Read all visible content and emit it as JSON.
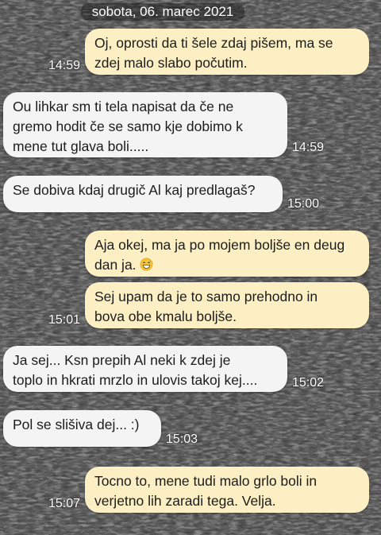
{
  "date_label": "sobota, 06. marec 2021",
  "messages": [
    {
      "side": "out",
      "text": "Oj, oprosti da ti šele zdaj pišem, ma se\nzdej malo slabo počutim.",
      "time": "14:59"
    },
    {
      "side": "in",
      "text": "Ou lihkar sm ti tela napisat da če ne\ngremo hodit če se samo kje dobimo k\nmene tut glava boli.....",
      "time": "14:59"
    },
    {
      "side": "in",
      "text": "Se dobiva kdaj drugič Al kaj predlagaš?",
      "time": "15:00"
    },
    {
      "side": "out",
      "text": "Aja okej, ma ja po mojem boljše en deug\ndan ja.",
      "emoji": "grinning-sweat-emoji",
      "time": ""
    },
    {
      "side": "out",
      "text": "Sej upam da je to samo prehodno in\nbova obe kmalu boljše.",
      "time": "15:01"
    },
    {
      "side": "in",
      "text": "Ja sej... Ksn prepih Al neki k zdej je\ntoplo in hkrati mrzlo in ulovis takoj kej....",
      "time": "15:02"
    },
    {
      "side": "in",
      "text": "Pol se slišiva dej... :)",
      "time": "15:03"
    },
    {
      "side": "out",
      "text": "Tocno to, mene tudi malo grlo boli in\nverjetno lih zaradi tega. Velja.",
      "time": "15:07"
    }
  ],
  "colors": {
    "outgoing_bubble": "#fcefc4",
    "incoming_bubble": "#f4f4f4",
    "timestamp": "#ffffff"
  }
}
